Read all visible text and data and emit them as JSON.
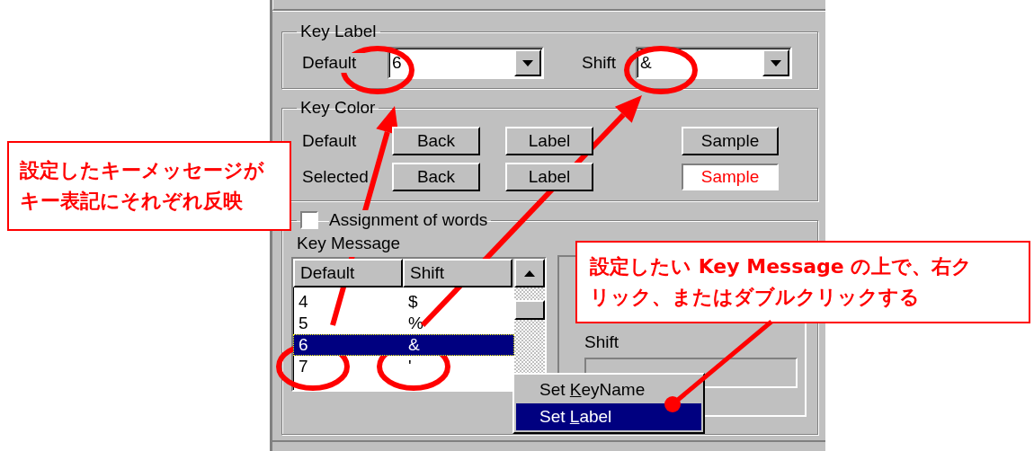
{
  "key_label": {
    "title": "Key Label",
    "default_label": "Default",
    "default_value": "6",
    "shift_label": "Shift",
    "shift_value": "&"
  },
  "key_color": {
    "title": "Key Color",
    "rows": [
      {
        "label": "Default",
        "back": "Back",
        "label_button": "Label",
        "sample": {
          "text": "Sample",
          "kind": "button"
        }
      },
      {
        "label": "Selected",
        "back": "Back",
        "label_button": "Label",
        "sample": {
          "text": "Sample",
          "kind": "preview"
        }
      }
    ]
  },
  "assignment": {
    "label": "Assignment of words",
    "checked": false
  },
  "key_message": {
    "title": "Key Message",
    "columns": [
      "Default",
      "Shift"
    ],
    "rows": [
      {
        "default": "4",
        "shift": "$",
        "selected": false
      },
      {
        "default": "5",
        "shift": "%",
        "selected": false
      },
      {
        "default": "6",
        "shift": "&",
        "selected": true
      },
      {
        "default": "7",
        "shift": "'",
        "selected": false
      }
    ]
  },
  "detail_pane": {
    "shift_label": "Shift"
  },
  "context_menu": {
    "items": [
      {
        "label_before": "Set ",
        "mnemonic": "K",
        "label_after": "eyName",
        "selected": false
      },
      {
        "label_before": "Set ",
        "mnemonic": "L",
        "label_after": "abel",
        "selected": true
      }
    ]
  },
  "callouts": [
    {
      "kind": "left",
      "lines": [
        "設定したキーメッセージが",
        "キー表記にそれぞれ反映"
      ]
    },
    {
      "kind": "right",
      "lines": [
        "設定したい Key Message の上で、右ク",
        "リック、またはダブルクリックする"
      ]
    }
  ]
}
